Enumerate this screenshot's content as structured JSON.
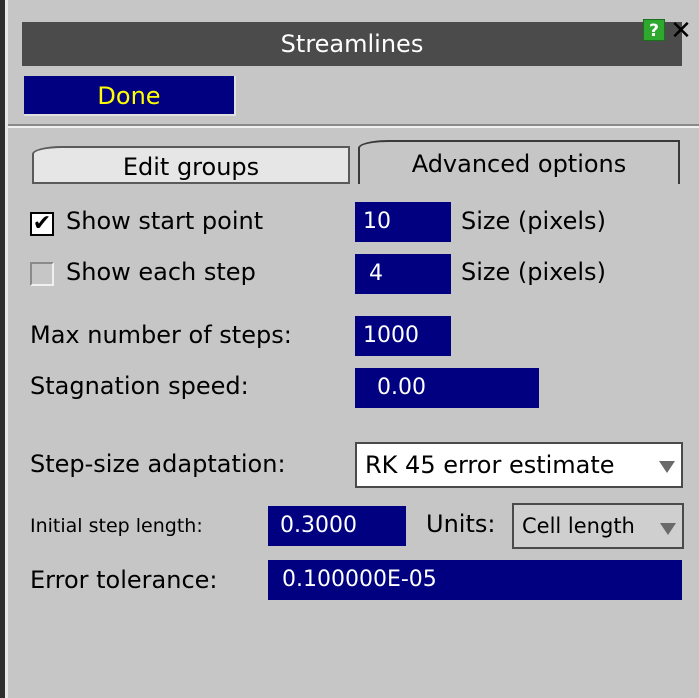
{
  "window": {
    "title": "Streamlines",
    "help_label": "?",
    "close_label": "✕"
  },
  "toolbar": {
    "done_label": "Done"
  },
  "tabs": [
    {
      "label": "Edit groups",
      "active": false
    },
    {
      "label": "Advanced options",
      "active": true
    }
  ],
  "options": {
    "show_start_point": {
      "label": "Show start point",
      "checked": true,
      "check_glyph": "✔",
      "size_value": "10",
      "size_label": "Size (pixels)"
    },
    "show_each_step": {
      "label": "Show each step",
      "checked": false,
      "size_value": "4",
      "size_label": "Size (pixels)"
    },
    "max_steps": {
      "label": "Max number of steps:",
      "value": "1000"
    },
    "stagnation_speed": {
      "label": "Stagnation speed:",
      "value": "0.00"
    },
    "step_size_adaptation": {
      "label": "Step-size adaptation:",
      "selected": "RK 45 error estimate"
    },
    "initial_step_length": {
      "label": "Initial step length:",
      "value": "0.3000",
      "units_label": "Units:",
      "units_selected": "Cell length"
    },
    "error_tolerance": {
      "label": "Error tolerance:",
      "value": "0.100000E-05"
    }
  },
  "icons": {
    "help": "help-icon",
    "close": "close-icon",
    "checkmark": "checkmark-icon",
    "dropdown": "dropdown-arrow-icon"
  },
  "colors": {
    "title_bar": "#4b4b4b",
    "field_bg": "#000080",
    "done_text": "#ffff00",
    "panel_bg": "#c6c6c6",
    "help_green": "#2ea82e"
  }
}
